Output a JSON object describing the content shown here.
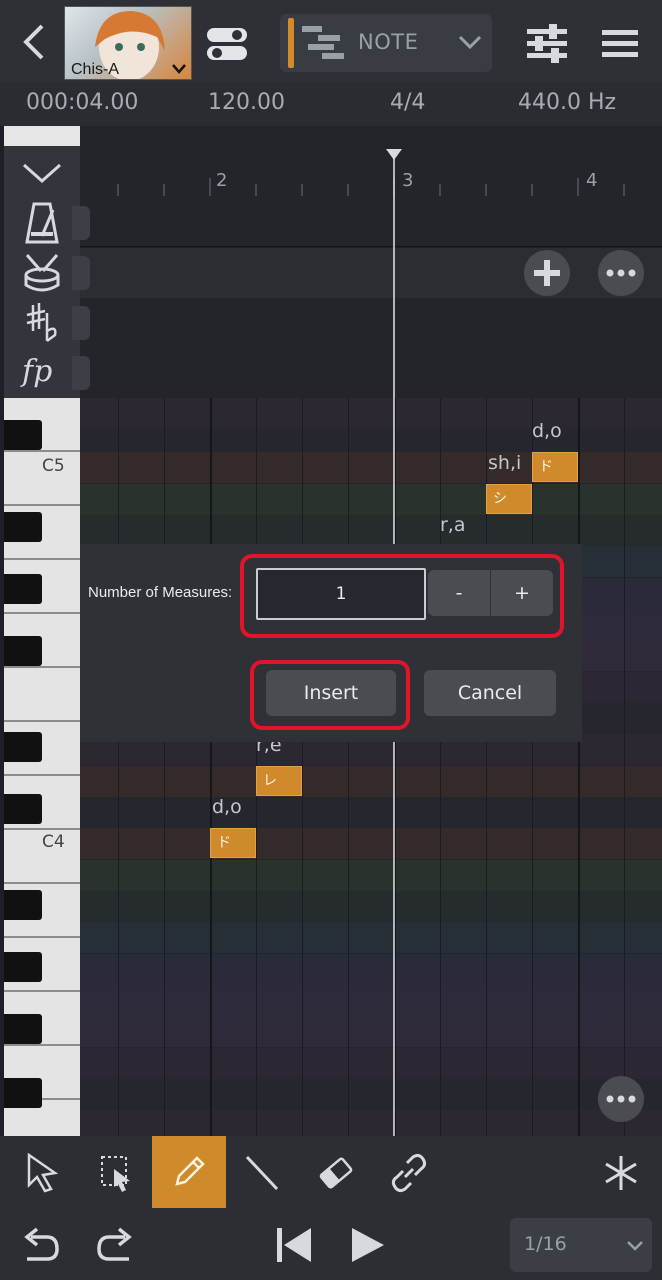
{
  "header": {
    "voice_name": "Chis-A",
    "mode": "NOTE"
  },
  "info": {
    "time": "000:04.00",
    "tempo": "120.00",
    "time_signature": "4/4",
    "pitch": "440.0 Hz"
  },
  "ruler": {
    "measures": [
      "2",
      "3",
      "4"
    ]
  },
  "keys": {
    "c5": "C5",
    "c4": "C4"
  },
  "notes": [
    {
      "lyric": "d,o",
      "kana": "ド"
    },
    {
      "lyric": "sh,i",
      "kana": "シ"
    },
    {
      "lyric": "r,a",
      "kana": ""
    },
    {
      "lyric": "r,e",
      "kana": "レ"
    },
    {
      "lyric": "d,o",
      "kana": "ド"
    }
  ],
  "dialog": {
    "label": "Number of Measures:",
    "value": "1",
    "minus": "-",
    "plus": "+",
    "insert": "Insert",
    "cancel": "Cancel"
  },
  "footer": {
    "quantize": "1/16"
  },
  "colors": {
    "accent": "#cf8a2b",
    "highlight": "#e0142a"
  }
}
